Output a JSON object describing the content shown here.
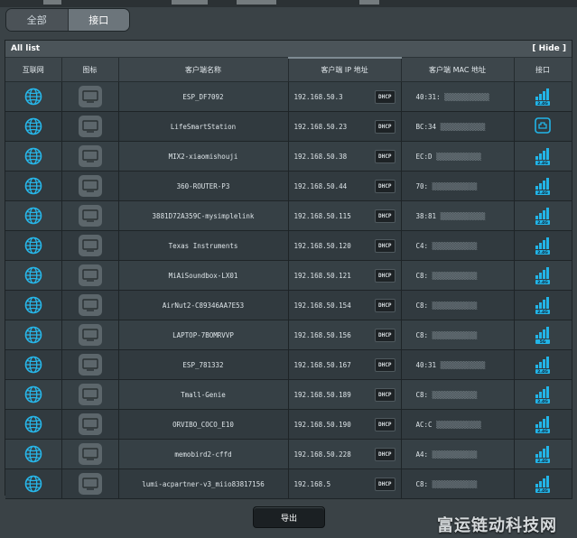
{
  "tabs": [
    "全部",
    "接口"
  ],
  "panel": {
    "title": "All list",
    "hide_label": "[ Hide ]"
  },
  "columns": [
    "互联网",
    "图标",
    "客户端名称",
    "客户端 IP 地址",
    "客户端 MAC 地址",
    "接口"
  ],
  "rows": [
    {
      "name": "ESP_DF7092",
      "ip": "192.168.50.3",
      "ip_tag": "DHCP",
      "mac": "40:31:",
      "port": "2.4G"
    },
    {
      "name": "LifeSmartStation",
      "ip": "192.168.50.23",
      "ip_tag": "DHCP",
      "mac": "BC:34",
      "port": "wired"
    },
    {
      "name": "MIX2-xiaomishouji",
      "ip": "192.168.50.38",
      "ip_tag": "DHCP",
      "mac": "EC:D",
      "port": "2.4G"
    },
    {
      "name": "360-ROUTER-P3",
      "ip": "192.168.50.44",
      "ip_tag": "DHCP",
      "mac": "70:",
      "port": "2.4G"
    },
    {
      "name": "3881D72A359C-mysimplelink",
      "ip": "192.168.50.115",
      "ip_tag": "DHCP",
      "mac": "38:81",
      "port": "2.4G"
    },
    {
      "name": "Texas Instruments",
      "ip": "192.168.50.120",
      "ip_tag": "DHCP",
      "mac": "C4:",
      "port": "2.4G"
    },
    {
      "name": "MiAiSoundbox-LX01",
      "ip": "192.168.50.121",
      "ip_tag": "DHCP",
      "mac": "C8:",
      "port": "2.4G"
    },
    {
      "name": "AirNut2-C89346AA7E53",
      "ip": "192.168.50.154",
      "ip_tag": "DHCP",
      "mac": "C8:",
      "port": "2.4G"
    },
    {
      "name": "LAPTOP-7BOMRVVP",
      "ip": "192.168.50.156",
      "ip_tag": "DHCP",
      "mac": "C8:",
      "port": "5G"
    },
    {
      "name": "ESP_781332",
      "ip": "192.168.50.167",
      "ip_tag": "DHCP",
      "mac": "40:31",
      "port": "2.4G"
    },
    {
      "name": "Tmall-Genie",
      "ip": "192.168.50.189",
      "ip_tag": "DHCP",
      "mac": "C8:",
      "port": "2.4G"
    },
    {
      "name": "ORVIBO_COCO_E10",
      "ip": "192.168.50.190",
      "ip_tag": "DHCP",
      "mac": "AC:C",
      "port": "2.4G"
    },
    {
      "name": "memobird2-cffd",
      "ip": "192.168.50.228",
      "ip_tag": "DHCP",
      "mac": "A4:",
      "port": "2.4G"
    },
    {
      "name": "lumi-acpartner-v3_miio83817156",
      "ip": "192.168.5",
      "ip_tag": "DHCP",
      "mac": "C8:",
      "port": "2.4G"
    }
  ],
  "export_label": "导出",
  "watermark": "富运链动科技网",
  "icons": {
    "internet": "globe-icon",
    "device": "monitor-icon",
    "wifi": "wifi-signal-icon",
    "wired": "ethernet-icon"
  },
  "colors": {
    "accent": "#22b5e8",
    "background": "#3a4246",
    "panel": "#2c3337"
  }
}
